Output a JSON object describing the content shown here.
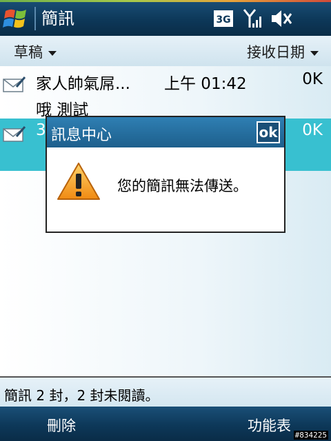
{
  "titlebar": {
    "app_title": "簡訊",
    "network_label": "3G"
  },
  "toolbar": {
    "folder_label": "草稿",
    "sort_label": "接收日期"
  },
  "messages": [
    {
      "sender": "家人帥氣屌...",
      "time": "上午 01:42",
      "size": "0K",
      "preview": "哦 測試"
    },
    {
      "sender": "3",
      "time": "",
      "size": "0K",
      "preview": ""
    }
  ],
  "dialog": {
    "title": "訊息中心",
    "ok_label": "ok",
    "message": "您的簡訊無法傳送。"
  },
  "status": {
    "text": "簡訊 2 封，2 封未閱讀。"
  },
  "softkeys": {
    "left": "刪除",
    "right": "功能表"
  },
  "watermark": "#834225",
  "colors": {
    "titlebar": "#0d3859",
    "selected_row": "#38c0d0",
    "dialog_header": "#2f7fb3"
  }
}
